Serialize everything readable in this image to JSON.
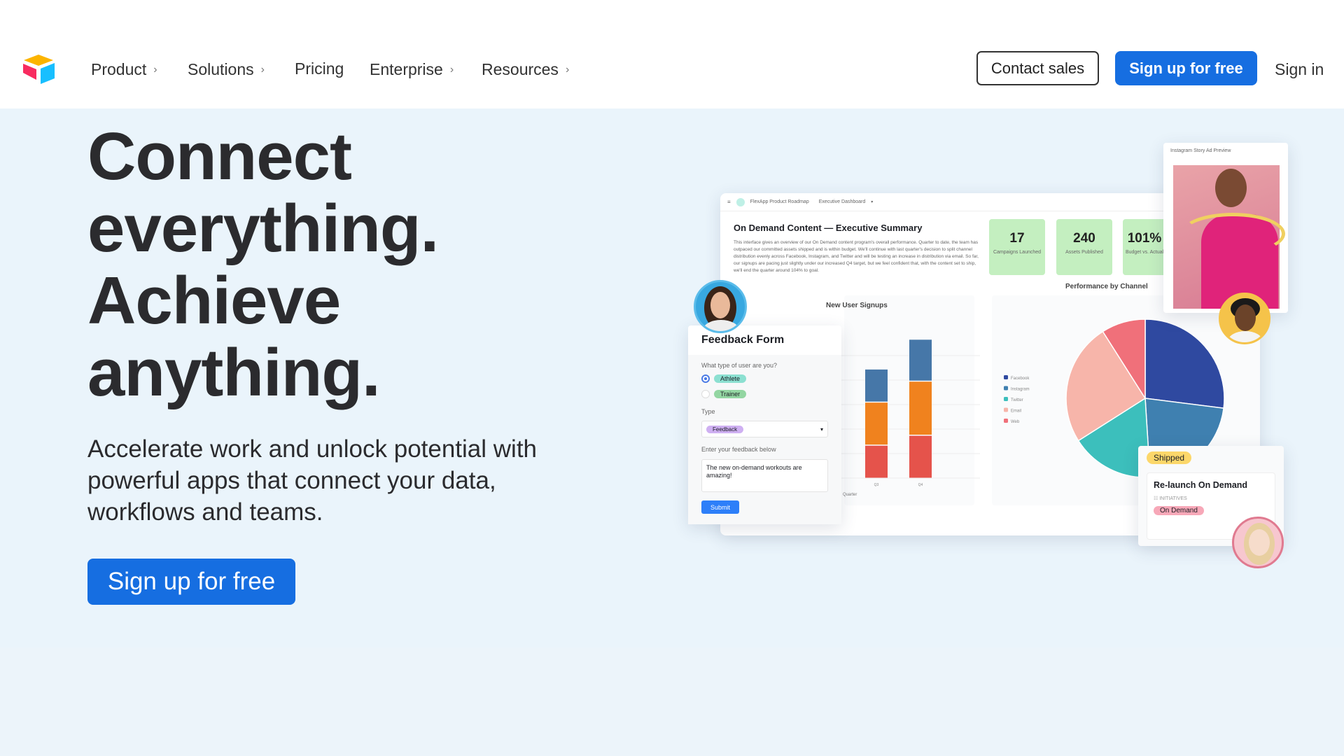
{
  "nav": {
    "items": [
      {
        "label": "Product",
        "has_chevron": true
      },
      {
        "label": "Solutions",
        "has_chevron": true
      },
      {
        "label": "Pricing",
        "has_chevron": false
      },
      {
        "label": "Enterprise",
        "has_chevron": true
      },
      {
        "label": "Resources",
        "has_chevron": true
      }
    ],
    "contact_sales": "Contact sales",
    "signup": "Sign up for free",
    "signin": "Sign in"
  },
  "hero": {
    "lines": [
      "Connect",
      "everything.",
      "Achieve",
      "anything."
    ],
    "subtitle": "Accelerate work and unlock potential with powerful apps that connect your data, workflows and teams.",
    "cta": "Sign up for free"
  },
  "colors": {
    "accent": "#166ee1",
    "background": "#eaf4fb",
    "stat_green": "#c4efc0"
  },
  "dashboard": {
    "breadcrumb": [
      "FlexApp Product Roadmap",
      "Executive Dashboard"
    ],
    "title": "On Demand Content — Executive Summary",
    "description": "This interface gives an overview of our On Demand content program's overall performance. Quarter to date, the team has outpaced our committed assets shipped and is within budget. We'll continue with last quarter's decision to split channel distribution evenly across Facebook, Instagram, and Twitter and will be testing an increase in distribution via email. So far, our signups are pacing just slightly under our increased Q4 target, but we feel confident that, with the content set to ship, we'll end the quarter around 104% to goal.",
    "stats": [
      {
        "value": "17",
        "label": "Campaigns Launched"
      },
      {
        "value": "240",
        "label": "Assets Published"
      },
      {
        "value": "101%",
        "label": "Budget vs. Actual"
      }
    ]
  },
  "chart_data": [
    {
      "type": "bar",
      "title": "New User Signups",
      "xlabel": "Quarter",
      "categories": [
        "Q3",
        "Q4"
      ],
      "series": [
        {
          "color": "#e5534b",
          "values": [
            30,
            39
          ]
        },
        {
          "color": "#f0821e",
          "values": [
            39,
            49
          ]
        },
        {
          "color": "#4677a8",
          "values": [
            30,
            38
          ]
        }
      ]
    },
    {
      "type": "pie",
      "title": "Performance by Channel",
      "legend": [
        "Facebook",
        "Instagram",
        "Twitter",
        "Email",
        "Web"
      ],
      "values": [
        27,
        22,
        17,
        25,
        9
      ],
      "colors": [
        "#2f49a0",
        "#3f80b0",
        "#3cbfbc",
        "#f7b5aa",
        "#f0707a"
      ],
      "legend_placement": "left"
    }
  ],
  "feedback": {
    "title": "Feedback Form",
    "question": "What type of user are you?",
    "options": [
      {
        "label": "Athlete",
        "selected": true
      },
      {
        "label": "Trainer",
        "selected": false
      }
    ],
    "type_label": "Type",
    "type_value": "Feedback",
    "feedback_label": "Enter your feedback below",
    "feedback_value": "The new on-demand workouts are amazing!",
    "submit": "Submit"
  },
  "instagram": {
    "title": "Instagram Story Ad Preview"
  },
  "shipped": {
    "badge": "Shipped",
    "title": "Re-launch On Demand",
    "field": "INITIATIVES",
    "tag": "On Demand"
  }
}
